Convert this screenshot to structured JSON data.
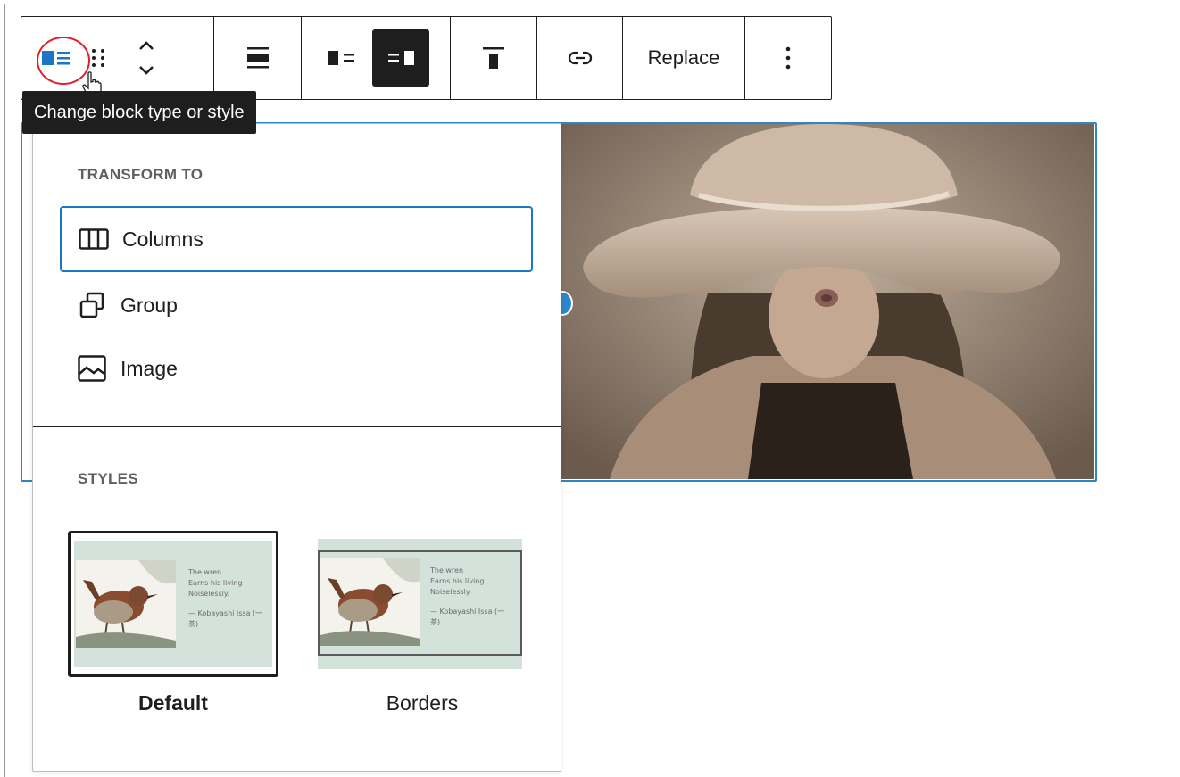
{
  "toolbar": {
    "replace_label": "Replace",
    "tooltip": "Change block type or style"
  },
  "dropdown": {
    "transform_title": "TRANSFORM TO",
    "transform_items": [
      {
        "label": "Columns",
        "icon": "columns-icon"
      },
      {
        "label": "Group",
        "icon": "group-icon"
      },
      {
        "label": "Image",
        "icon": "image-icon"
      }
    ],
    "styles_title": "STYLES",
    "styles": [
      {
        "label": "Default",
        "selected": true
      },
      {
        "label": "Borders",
        "selected": false
      }
    ],
    "preview_text": {
      "line1": "The wren",
      "line2": "Earns his living",
      "line3": "Noiselessly.",
      "line4": "— Kobayashi Issa (一",
      "line5": "茶)"
    }
  },
  "colors": {
    "accent": "#2c86c8",
    "highlight_circle": "#e0202a",
    "preview_bg": "#d3e3dc"
  }
}
